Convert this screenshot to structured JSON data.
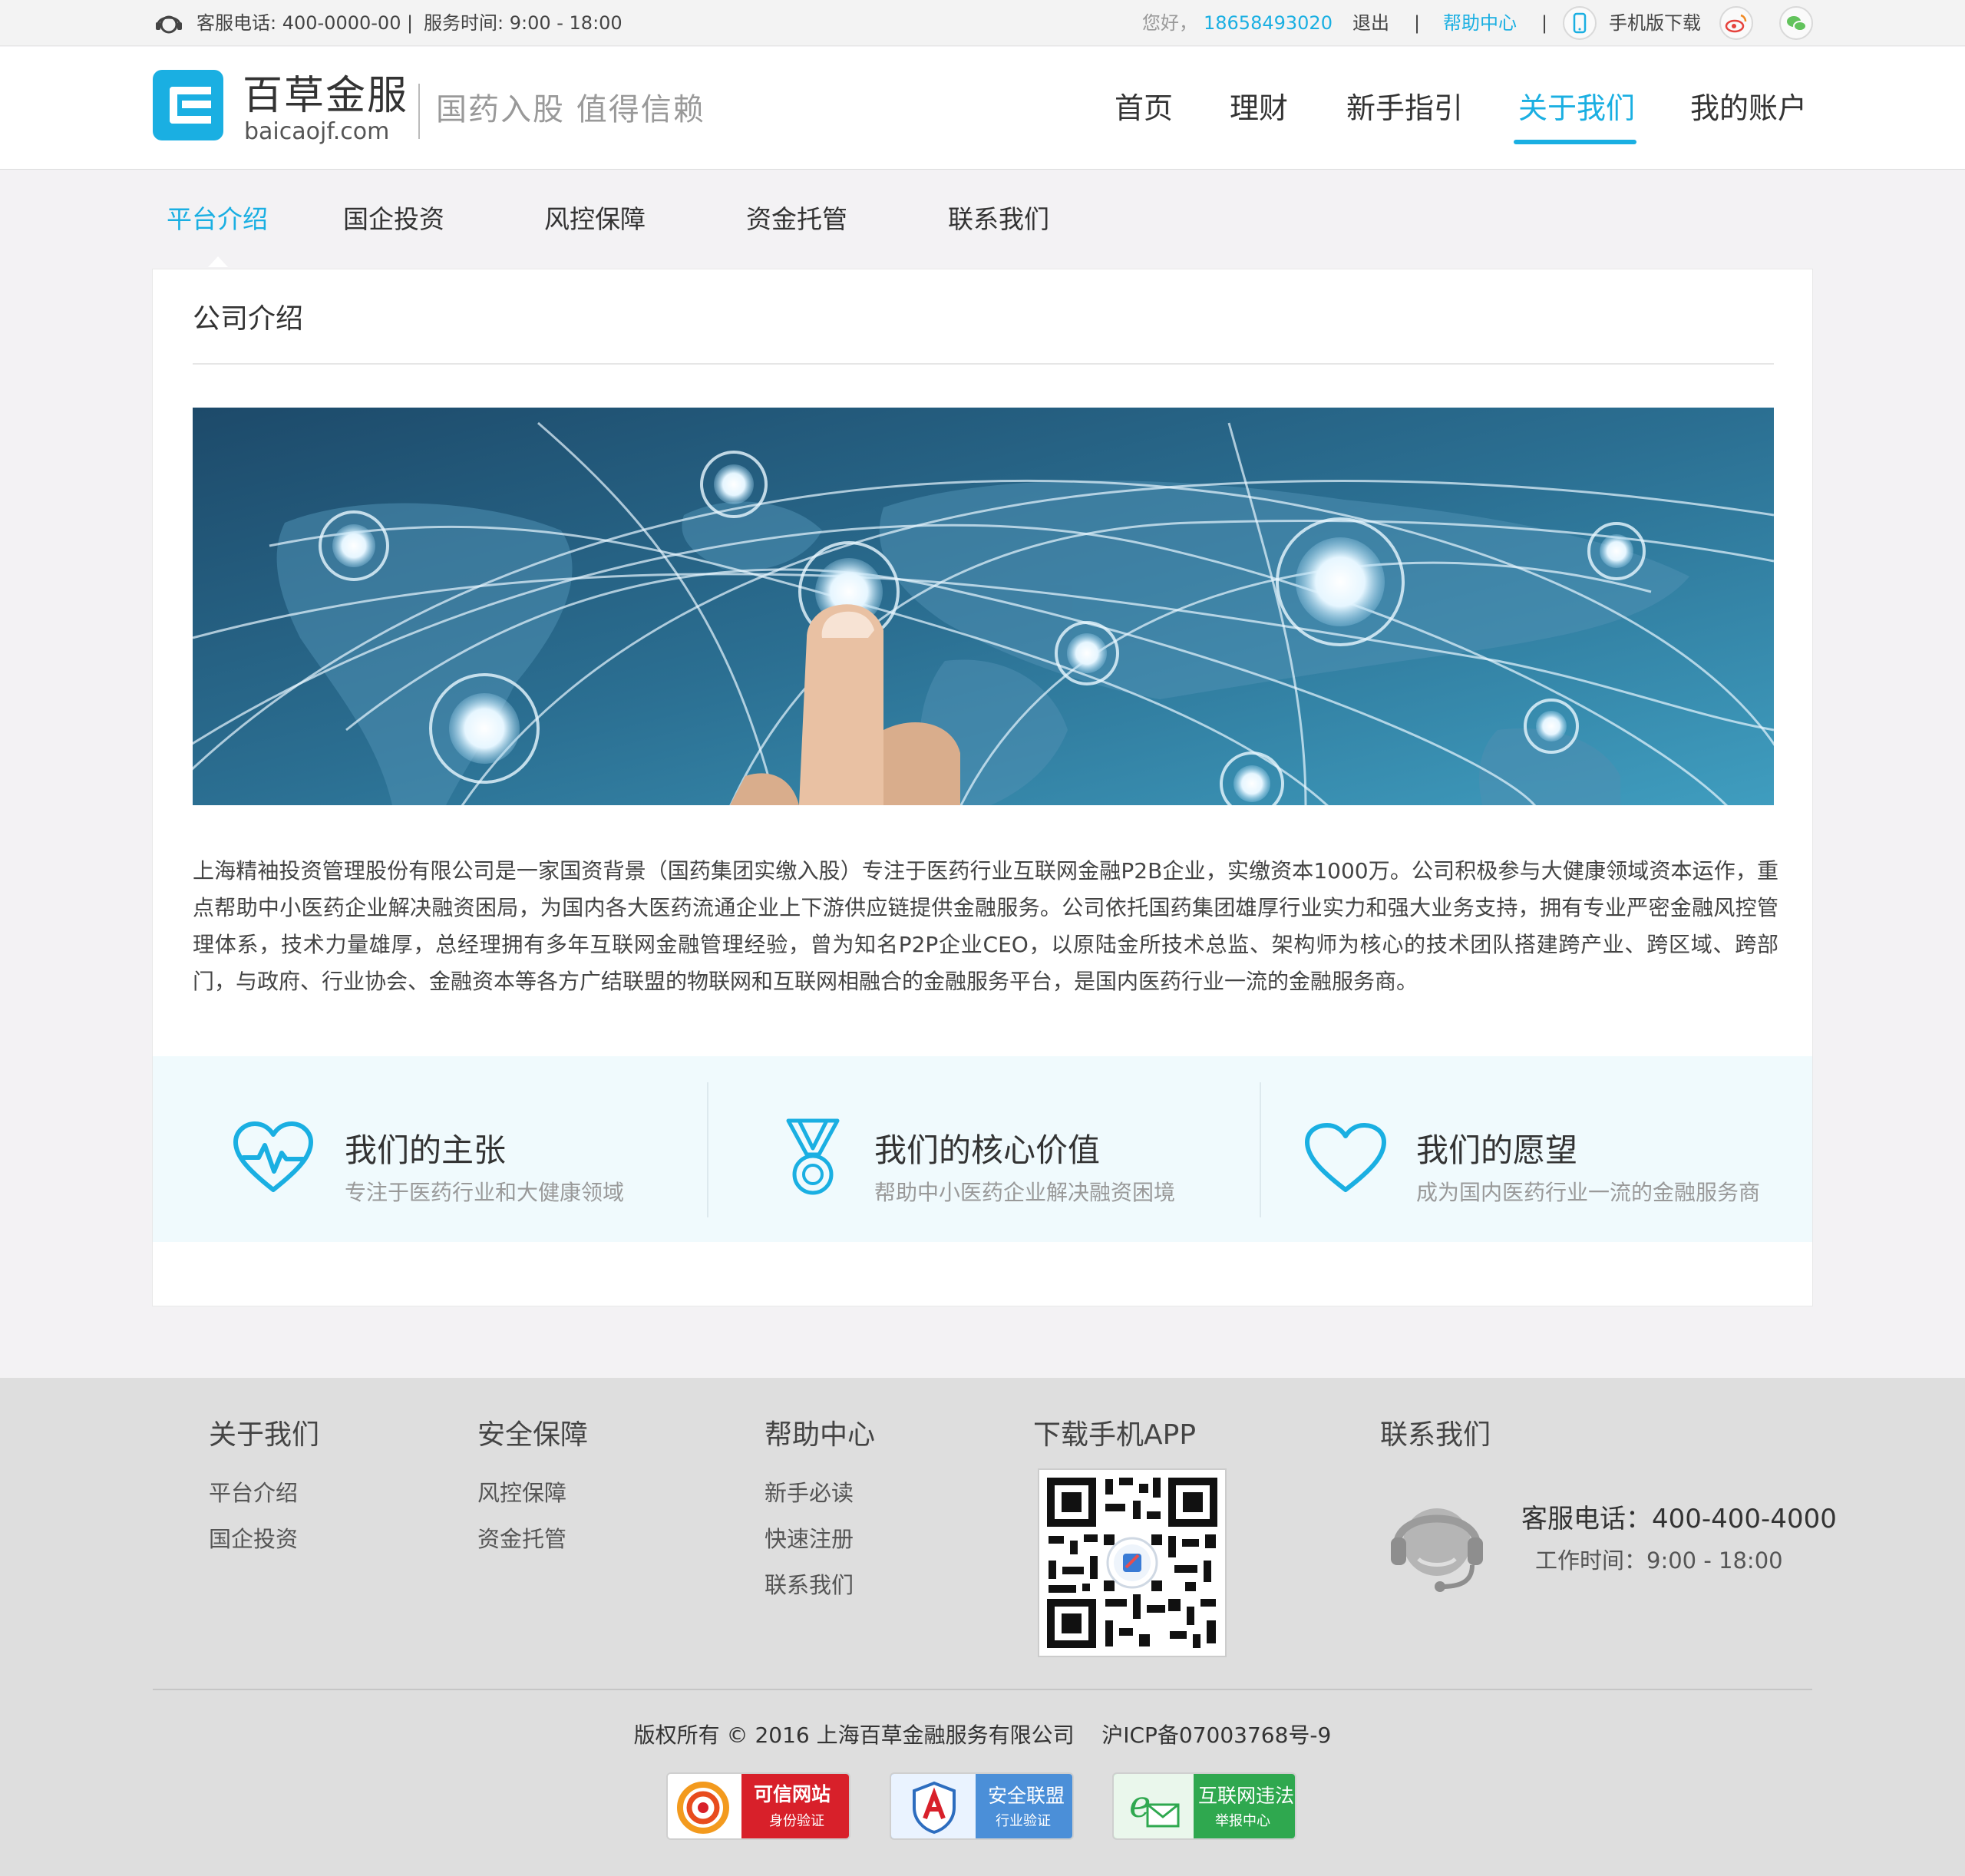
{
  "topbar": {
    "service_phone": "客服电话: 400-0000-00",
    "separator": "|",
    "service_time": "服务时间: 9:00 - 18:00",
    "greeting": "您好，",
    "user_phone": "18658493020",
    "logout": "退出",
    "help": "帮助中心",
    "mobile_download": "手机版下载"
  },
  "header": {
    "logo_name": "百草金服",
    "logo_url": "baicaojf.com",
    "slogan": "国药入股  值得信赖",
    "nav": [
      "首页",
      "理财",
      "新手指引",
      "关于我们",
      "我的账户"
    ],
    "active_nav": "关于我们"
  },
  "subnav": [
    "平台介绍",
    "国企投资",
    "风控保障",
    "资金托管",
    "联系我们"
  ],
  "content": {
    "title": "公司介绍",
    "paragraph": "上海精袖投资管理股份有限公司是一家国资背景（国药集团实缴入股）专注于医药行业互联网金融P2B企业，实缴资本1000万。公司积极参与大健康领域资本运作，重点帮助中小医药企业解决融资困局，为国内各大医药流通企业上下游供应链提供金融服务。公司依托国药集团雄厚行业实力和强大业务支持，拥有专业严密金融风控管理体系，技术力量雄厚，总经理拥有多年互联网金融管理经验，曾为知名P2P企业CEO，以原陆金所技术总监、架构师为核心的技术团队搭建跨产业、跨区域、跨部门，与政府、行业协会、金融资本等各方广结联盟的物联网和互联网相融合的金融服务平台，是国内医药行业一流的金融服务商。",
    "features": [
      {
        "title": "我们的主张",
        "subtitle": "专注于医药行业和大健康领域",
        "icon": "heartbeat-icon"
      },
      {
        "title": "我们的核心价值",
        "subtitle": "帮助中小医药企业解决融资困境",
        "icon": "medal-icon"
      },
      {
        "title": "我们的愿望",
        "subtitle": "成为国内医药行业一流的金融服务商",
        "icon": "heart-icon"
      }
    ]
  },
  "footer": {
    "columns": [
      {
        "heading": "关于我们",
        "links": [
          "平台介绍",
          "国企投资"
        ]
      },
      {
        "heading": "安全保障",
        "links": [
          "风控保障",
          "资金托管"
        ]
      },
      {
        "heading": "帮助中心",
        "links": [
          "新手必读",
          "快速注册",
          "联系我们"
        ]
      }
    ],
    "app_heading": "下载手机APP",
    "contact_heading": "联系我们",
    "contact_phone": "客服电话：400-400-4000",
    "contact_hours": "工作时间：9:00 - 18:00",
    "copyright": "版权所有 © 2016 上海百草金融服务有限公司    沪ICP备07003768号-9",
    "badges": [
      {
        "line1": "可信网站",
        "line2": "身份验证"
      },
      {
        "line1": "安全联盟",
        "line2": "行业验证"
      },
      {
        "line1": "互联网违法",
        "line2": "举报中心"
      }
    ]
  },
  "colors": {
    "accent": "#1aafe2",
    "footer_bg": "#dedede",
    "page_bg": "#f3f2f4"
  }
}
